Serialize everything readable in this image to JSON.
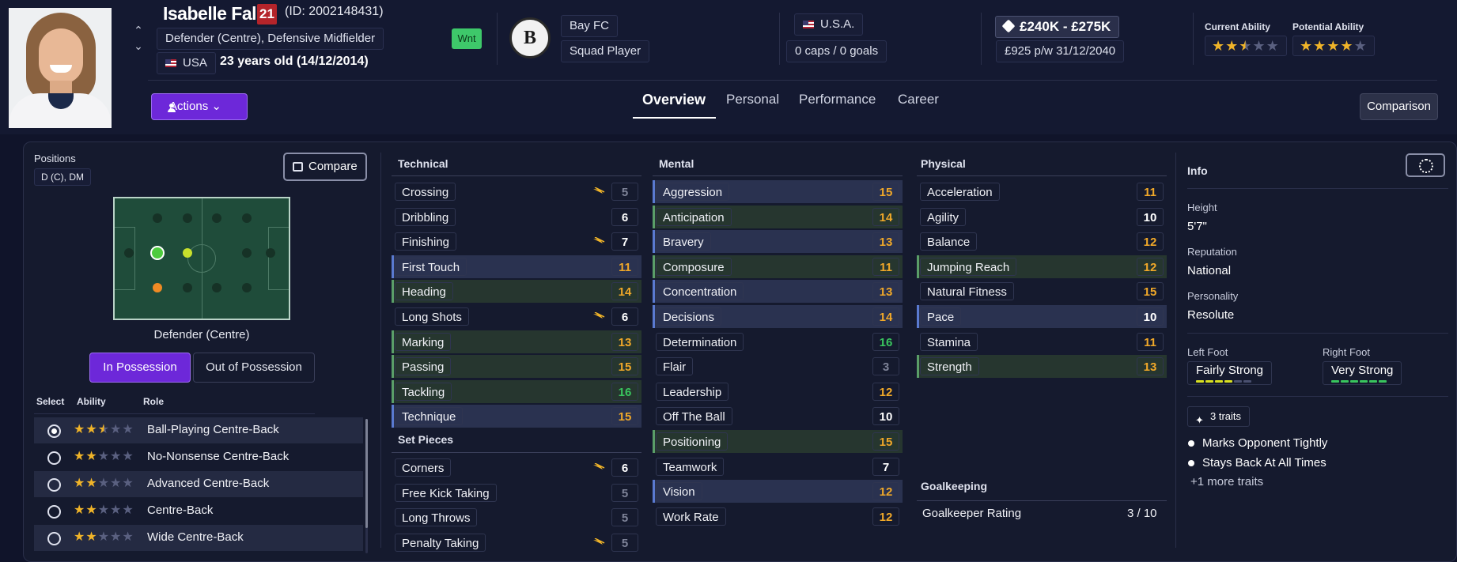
{
  "player": {
    "name": "Isabelle Falk",
    "number": "21",
    "id": "(ID: 2002148431)",
    "positions_desc": "Defender (Centre), Defensive Midfielder",
    "nationality": "USA",
    "age": "23 years old (14/12/2014)",
    "wnt_badge": "Wnt"
  },
  "club": {
    "name": "Bay FC",
    "status": "Squad Player",
    "crest_letter": "B"
  },
  "international": {
    "country": "U.S.A.",
    "caps": "0 caps / 0 goals"
  },
  "contract": {
    "value": "£240K - £275K",
    "wage": "£925 p/w",
    "expires": "31/12/2040"
  },
  "ability": {
    "current_label": "Current Ability",
    "current_stars": 2.5,
    "potential_label": "Potential Ability",
    "potential_stars": 4
  },
  "nav": {
    "actions_label": "Actions",
    "tabs": [
      "Overview",
      "Personal",
      "Performance",
      "Career"
    ],
    "active_tab": "Overview",
    "comparison_label": "Comparison"
  },
  "positions": {
    "label": "Positions",
    "value": "D (C), DM",
    "compare_label": "Compare",
    "selected_role": "Defender (Centre)",
    "in_possession": "In Possession",
    "out_of_possession": "Out of Possession",
    "headers": {
      "select": "Select",
      "ability": "Ability",
      "role": "Role"
    },
    "roles": [
      {
        "name": "Ball-Playing Centre-Back",
        "stars": 2.5,
        "selected": true
      },
      {
        "name": "No-Nonsense Centre-Back",
        "stars": 2,
        "selected": false
      },
      {
        "name": "Advanced Centre-Back",
        "stars": 2,
        "selected": false
      },
      {
        "name": "Centre-Back",
        "stars": 2,
        "selected": false
      },
      {
        "name": "Wide Centre-Back",
        "stars": 2,
        "selected": false
      }
    ]
  },
  "attributes": {
    "technical": {
      "title": "Technical",
      "items": [
        {
          "name": "Crossing",
          "value": "5"
        },
        {
          "name": "Dribbling",
          "value": "6"
        },
        {
          "name": "Finishing",
          "value": "7"
        },
        {
          "name": "First Touch",
          "value": "11"
        },
        {
          "name": "Heading",
          "value": "14"
        },
        {
          "name": "Long Shots",
          "value": "6"
        },
        {
          "name": "Marking",
          "value": "13"
        },
        {
          "name": "Passing",
          "value": "15"
        },
        {
          "name": "Tackling",
          "value": "16"
        },
        {
          "name": "Technique",
          "value": "15"
        }
      ]
    },
    "set_pieces": {
      "title": "Set Pieces",
      "items": [
        {
          "name": "Corners",
          "value": "6"
        },
        {
          "name": "Free Kick Taking",
          "value": "5"
        },
        {
          "name": "Long Throws",
          "value": "5"
        },
        {
          "name": "Penalty Taking",
          "value": "5"
        }
      ]
    },
    "mental": {
      "title": "Mental",
      "items": [
        {
          "name": "Aggression",
          "value": "15"
        },
        {
          "name": "Anticipation",
          "value": "14"
        },
        {
          "name": "Bravery",
          "value": "13"
        },
        {
          "name": "Composure",
          "value": "11"
        },
        {
          "name": "Concentration",
          "value": "13"
        },
        {
          "name": "Decisions",
          "value": "14"
        },
        {
          "name": "Determination",
          "value": "16"
        },
        {
          "name": "Flair",
          "value": "3"
        },
        {
          "name": "Leadership",
          "value": "12"
        },
        {
          "name": "Off The Ball",
          "value": "10"
        },
        {
          "name": "Positioning",
          "value": "15"
        },
        {
          "name": "Teamwork",
          "value": "7"
        },
        {
          "name": "Vision",
          "value": "12"
        },
        {
          "name": "Work Rate",
          "value": "12"
        }
      ]
    },
    "physical": {
      "title": "Physical",
      "items": [
        {
          "name": "Acceleration",
          "value": "11"
        },
        {
          "name": "Agility",
          "value": "10"
        },
        {
          "name": "Balance",
          "value": "12"
        },
        {
          "name": "Jumping Reach",
          "value": "12"
        },
        {
          "name": "Natural Fitness",
          "value": "15"
        },
        {
          "name": "Pace",
          "value": "10"
        },
        {
          "name": "Stamina",
          "value": "11"
        },
        {
          "name": "Strength",
          "value": "13"
        }
      ]
    },
    "goalkeeping": {
      "title": "Goalkeeping",
      "rating_label": "Goalkeeper Rating",
      "rating_value": "3 / 10"
    }
  },
  "info": {
    "title": "Info",
    "height_label": "Height",
    "height": "5'7\"",
    "reputation_label": "Reputation",
    "reputation": "National",
    "personality_label": "Personality",
    "personality": "Resolute",
    "left_foot_label": "Left Foot",
    "left_foot": "Fairly Strong",
    "left_foot_level": 4,
    "right_foot_label": "Right Foot",
    "right_foot": "Very Strong",
    "right_foot_level": 6,
    "traits_count": "3 traits",
    "traits": [
      "Marks Opponent Tightly",
      "Stays Back At All Times"
    ],
    "more_traits": "+1 more traits"
  },
  "colors": {
    "accent": "#6d28d9",
    "value_low": "#7e8398",
    "value_mid": "#ffffff",
    "value_good": "#f0a829",
    "value_great": "#39c55e",
    "trend_arrow": "#f0b429"
  }
}
